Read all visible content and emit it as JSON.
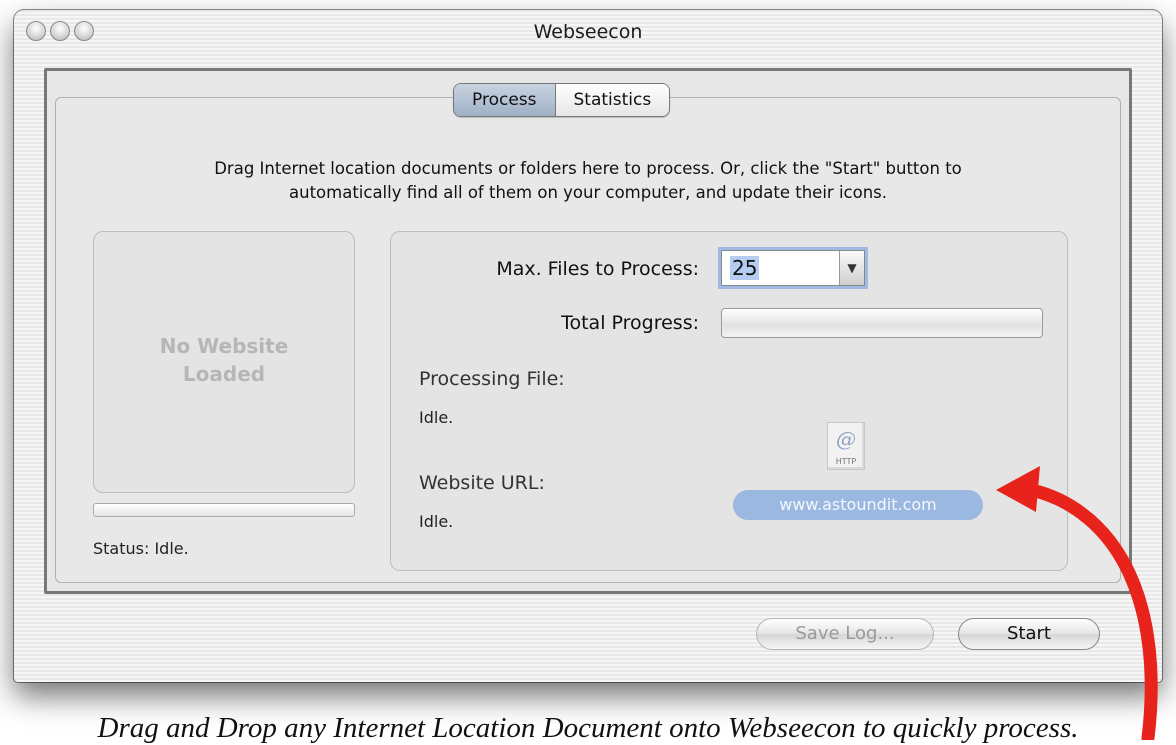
{
  "window": {
    "title": "Webseecon"
  },
  "tabs": [
    {
      "label": "Process",
      "selected": true
    },
    {
      "label": "Statistics",
      "selected": false
    }
  ],
  "instructions": {
    "line1": "Drag Internet location documents or folders here to process. Or, click the \"Start\" button to",
    "line2": "automatically find all of them on your computer, and update their icons."
  },
  "preview": {
    "placeholder_line1": "No Website",
    "placeholder_line2": "Loaded",
    "status": "Status: Idle."
  },
  "details": {
    "max_files_label": "Max. Files to Process:",
    "max_files_value": "25",
    "total_progress_label": "Total Progress:",
    "total_progress_fraction": 0,
    "processing_file_label": "Processing File:",
    "processing_file_value": "Idle.",
    "website_url_label": "Website URL:",
    "website_url_value": "Idle."
  },
  "drag_item": {
    "icon_glyph": "@",
    "icon_caption": "HTTP",
    "url": "www.astoundit.com"
  },
  "buttons": {
    "save_log": "Save Log...",
    "start": "Start"
  },
  "caption": "Drag and Drop any Internet Location Document onto Webseecon to quickly process.",
  "colors": {
    "arrow": "#e8231c",
    "selection_pill": "#9ab8e0",
    "focus_ring": "#9fbbe3"
  }
}
